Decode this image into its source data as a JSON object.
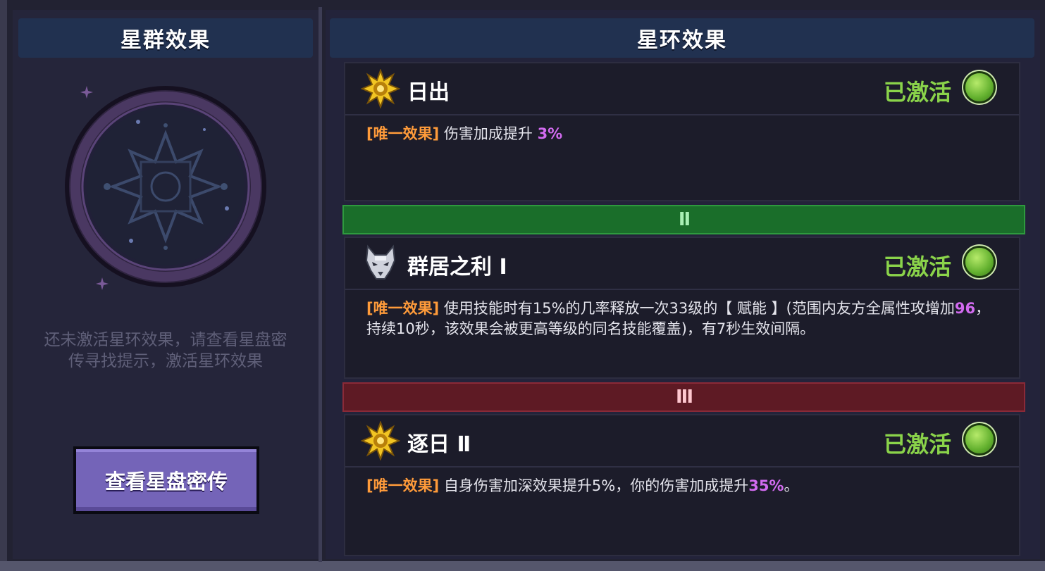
{
  "left_panel": {
    "title": "星群效果",
    "hint_line1": "还未激活星环效果，请查看星盘密",
    "hint_line2": "传寻找提示，激活星环效果",
    "button_label": "查看星盘密传"
  },
  "right_panel": {
    "title": "星环效果",
    "tiers": [
      {
        "label": "II",
        "color": "#1a6e2a"
      },
      {
        "label": "III",
        "color": "#5e1a24"
      }
    ],
    "effects": [
      {
        "icon": "sun-emblem-icon",
        "name": "日出",
        "status": "已激活",
        "tag": "[唯一效果]",
        "desc_before": " 伤害加成提升 ",
        "desc_hl": "3%",
        "desc_after": ""
      },
      {
        "icon": "wolf-head-icon",
        "name": "群居之利 Ⅰ",
        "status": "已激活",
        "tag": "[唯一效果]",
        "desc_before": " 使用技能时有15%的几率释放一次33级的【 赋能 】(范围内友方全属性攻增加",
        "desc_hl": "96",
        "desc_after": "，持续10秒，该效果会被更高等级的同名技能覆盖)，有7秒生效间隔。"
      },
      {
        "icon": "sun-emblem-icon",
        "name": "逐日 Ⅱ",
        "status": "已激活",
        "tag": "[唯一效果]",
        "desc_before": " 自身伤害加深效果提升5%，你的伤害加成提升",
        "desc_hl": "35%",
        "desc_after": "。"
      }
    ]
  },
  "colors": {
    "status_active": "#8ad34a",
    "tag": "#ff9b3a",
    "highlight": "#d26bf0",
    "button": "#7464b8"
  }
}
